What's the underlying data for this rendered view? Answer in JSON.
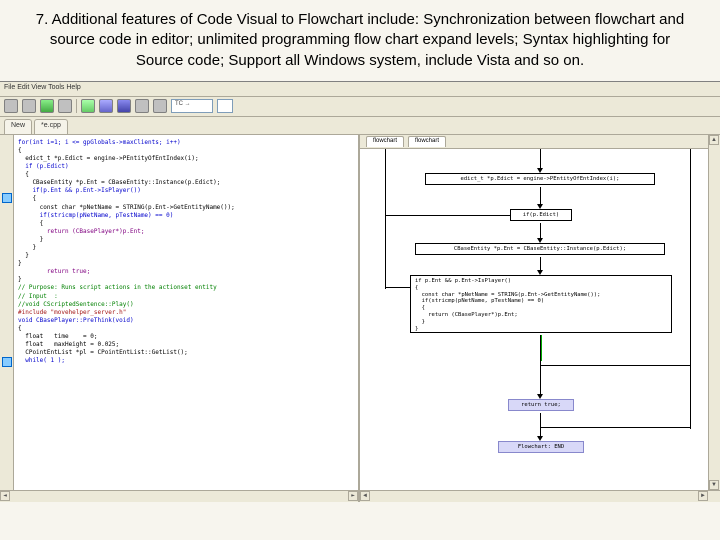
{
  "header": {
    "text": "7. Additional features of Code Visual to Flowchart include: Synchronization between flowchart and source code in editor; unlimited programming flow chart expand levels; Syntax highlighting for Source code; Support all Windows system, include Vista and so on."
  },
  "menubar": {
    "label": "File  Edit  View  Tools  Help"
  },
  "toolbar": {
    "dropdown": "TC →"
  },
  "tabs": {
    "left1": "New",
    "left2": "*e.cpp"
  },
  "flowtabs": {
    "t1": "flowchart",
    "t2": "flowchart"
  },
  "flowchart": {
    "n1": "edict_t *p.Edict = engine->PEntityOfEntIndex(i);",
    "n2": "if(p.Edict)",
    "n3": "CBaseEntity *p.Ent = CBaseEntity::Instance(p.Edict);",
    "n4": "if p.Ent && p.Ent->IsPlayer()\n{\n  const char *pNetName = STRING(p.Ent->GetEntityName());\n  if(stricmp(pNetName, pTestName) == 0)\n  {\n    return (CBasePlayer*)p.Ent;\n  }\n}",
    "n5": "return true;",
    "n6": "Flowchart: END"
  },
  "code": {
    "l1": "for(int i=1; i <= gpGlobals->maxClients; i++)",
    "l2": "{",
    "l3": "  edict_t *p.Edict = engine->PEntityOfEntIndex(i);",
    "l4": "  if (p.Edict)",
    "l5": "  {",
    "l6": "    CBaseEntity *p.Ent = CBaseEntity::Instance(p.Edict);",
    "l7": "    if(p.Ent && p.Ent->IsPlayer())",
    "l8": "    {",
    "l9": "      const char *pNetName = STRING(p.Ent->GetEntityName());",
    "l10": "      if(stricmp(pNetName, pTestName) == 0)",
    "l11": "      {",
    "l12": "        return (CBasePlayer*)p.Ent;",
    "l13": "      }",
    "l14": "    }",
    "l15": "  }",
    "l16": "}",
    "l17": "",
    "l18": "        return true;",
    "l19": "}",
    "l20": "",
    "l21": "// Purpose: Runs script actions in the actionset entity",
    "l22": "// Input  :",
    "l23": "//void CScriptedSentence::Play()",
    "l24": "",
    "l25": "#include \"movehelper_server.h\"",
    "l26": "void CBasePlayer::PreThink(void)",
    "l27": "{",
    "l28": "  float   time    = 0;",
    "l29": "  float   maxHeight = 0.025;",
    "l30": "  CPointEntList *pl = CPointEntList::GetList();",
    "l31": "  while( 1 );"
  }
}
